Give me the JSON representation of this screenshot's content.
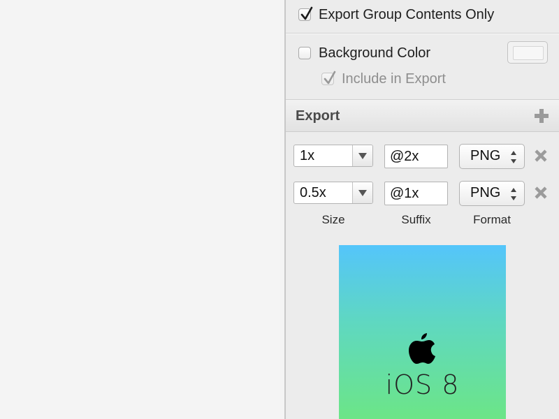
{
  "canvas": {},
  "inspector": {
    "export_group_contents_only": {
      "label": "Export Group Contents Only",
      "checked": true
    },
    "background_color": {
      "label": "Background Color",
      "checked": false,
      "swatch_color": "#f7f7f7"
    },
    "include_in_export": {
      "label": "Include in Export",
      "checked": true,
      "disabled": true
    },
    "export": {
      "title": "Export",
      "add_icon": "plus-icon",
      "rows": [
        {
          "size": "1x",
          "suffix": "@2x",
          "format": "PNG",
          "remove_icon": "close-x-icon"
        },
        {
          "size": "0.5x",
          "suffix": "@1x",
          "format": "PNG",
          "remove_icon": "close-x-icon"
        }
      ],
      "column_labels": {
        "size": "Size",
        "suffix": "Suffix",
        "format": "Format"
      }
    },
    "preview": {
      "logo_icon": "apple-logo-icon",
      "text": "iOS 8",
      "gradient_top": "#54c5fb",
      "gradient_bottom": "#6ce587"
    }
  }
}
